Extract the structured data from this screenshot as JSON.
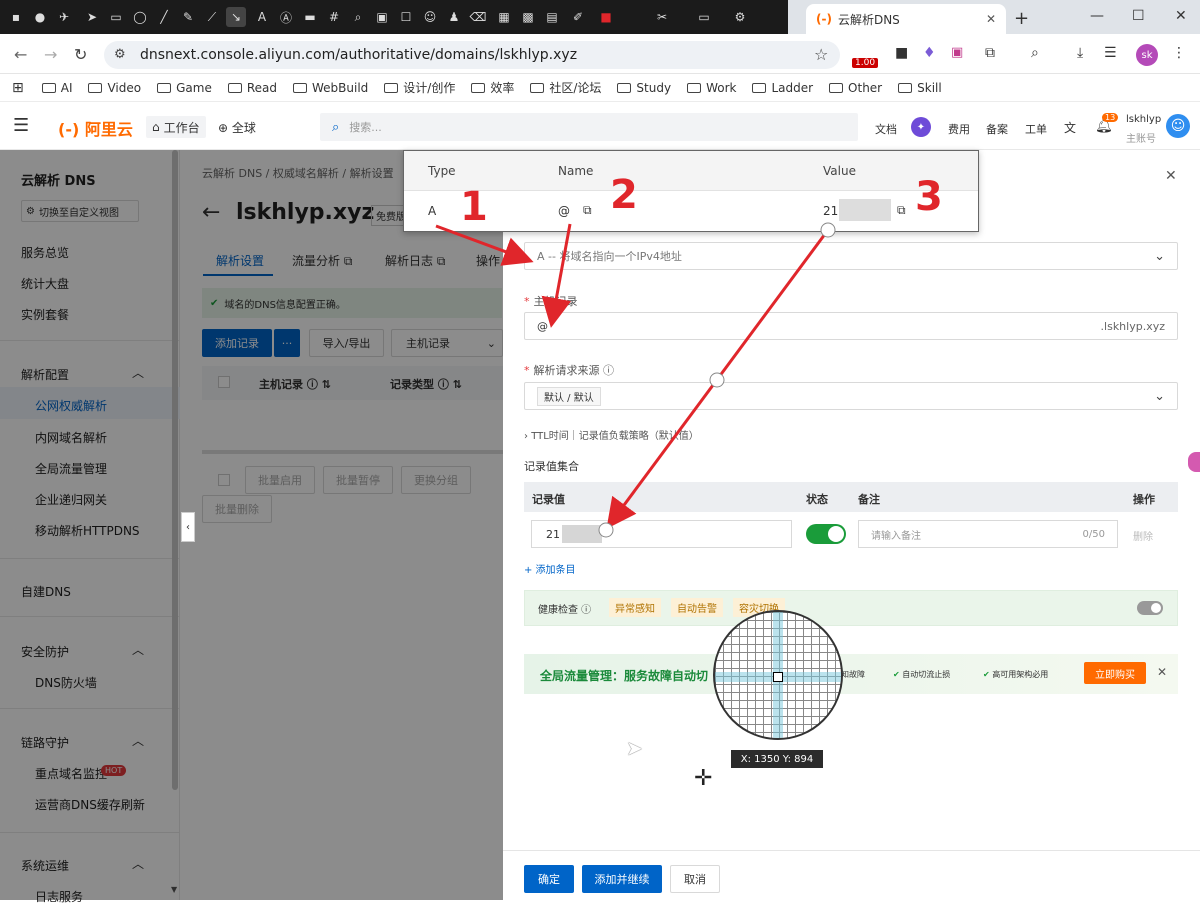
{
  "browser": {
    "tab_title": "云解析DNS",
    "tab_logo": "(-)",
    "url": "dnsnext.console.aliyun.com/authoritative/domains/lskhlyp.xyz",
    "bookmarks": [
      "AI",
      "Video",
      "Game",
      "Read",
      "WebBuild",
      "设计/创作",
      "效率",
      "社区/论坛",
      "Study",
      "Work",
      "Ladder",
      "Other",
      "Skill"
    ],
    "ext_badge": "1.00",
    "profile": "sk"
  },
  "appbar": {
    "logo": "阿里云",
    "workbench": "工作台",
    "region": "全球",
    "search_placeholder": "搜索...",
    "links": [
      "文档",
      "费用",
      "备案",
      "工单"
    ],
    "notif_count": "13",
    "username": "lskhlyp",
    "account_type": "主账号"
  },
  "sidebar": {
    "title": "云解析 DNS",
    "switch_view": "切换至自定义视图",
    "items": [
      "服务总览",
      "统计大盘",
      "实例套餐"
    ],
    "group1": "解析配置",
    "group1_items": [
      "公网权威解析",
      "内网域名解析",
      "全局流量管理",
      "企业递归网关",
      "移动解析HTTPDNS"
    ],
    "self_dns": "自建DNS",
    "group2": "安全防护",
    "group2_items": [
      "DNS防火墙"
    ],
    "group3": "链路守护",
    "group3_items": [
      "重点域名监控",
      "运营商DNS缓存刷新"
    ],
    "hot": "HOT",
    "group4": "系统运维",
    "group4_items": [
      "日志服务"
    ]
  },
  "main": {
    "breadcrumb": [
      "云解析 DNS",
      "权威域名解析",
      "解析设置"
    ],
    "domain": "lskhlyp.xyz",
    "domain_badge": "免费版",
    "tabs": [
      "解析设置",
      "流量分析",
      "解析日志",
      "操作"
    ],
    "notice": "域名的DNS信息配置正确。",
    "add_record": "添加记录",
    "more": "···",
    "import_export": "导入/导出",
    "host_filter": "主机记录",
    "col_host": "主机记录",
    "col_type": "记录类型",
    "batch_buttons": [
      "批量启用",
      "批量暂停",
      "更换分组"
    ],
    "batch_delete": "批量删除"
  },
  "drawer": {
    "record_type_value": "A -- 将域名指向一个IPv4地址",
    "host_label": "主机记录",
    "host_value": "@",
    "host_suffix": ".lskhlyp.xyz",
    "source_label": "解析请求来源",
    "source_value": "默认 / 默认",
    "ttl_row": "TTL时间｜记录值负载策略（默认值）",
    "values_title": "记录值集合",
    "col_value": "记录值",
    "col_status": "状态",
    "col_note": "备注",
    "col_action": "操作",
    "row_value": "21",
    "note_placeholder": "请输入备注",
    "note_count": "0/50",
    "row_delete": "删除",
    "add_item": "+ 添加条目",
    "health_label": "健康检查",
    "health_tags": [
      "异常感知",
      "自动告警",
      "容灾切换"
    ],
    "promo_title": "全局流量管理：服务故障自动切",
    "promo_points": [
      "知故障",
      "自动切流止损",
      "高可用架构必用"
    ],
    "promo_buy": "立即购买",
    "confirm": "确定",
    "add_continue": "添加并继续",
    "cancel": "取消"
  },
  "overlay": {
    "col_type": "Type",
    "col_name": "Name",
    "col_value": "Value",
    "type": "A",
    "name": "@",
    "value": "21"
  },
  "annotations": {
    "n1": "1",
    "n2": "2",
    "n3": "3",
    "coords": "X: 1350 Y: 894",
    "arrow_color": "#e0262b"
  }
}
